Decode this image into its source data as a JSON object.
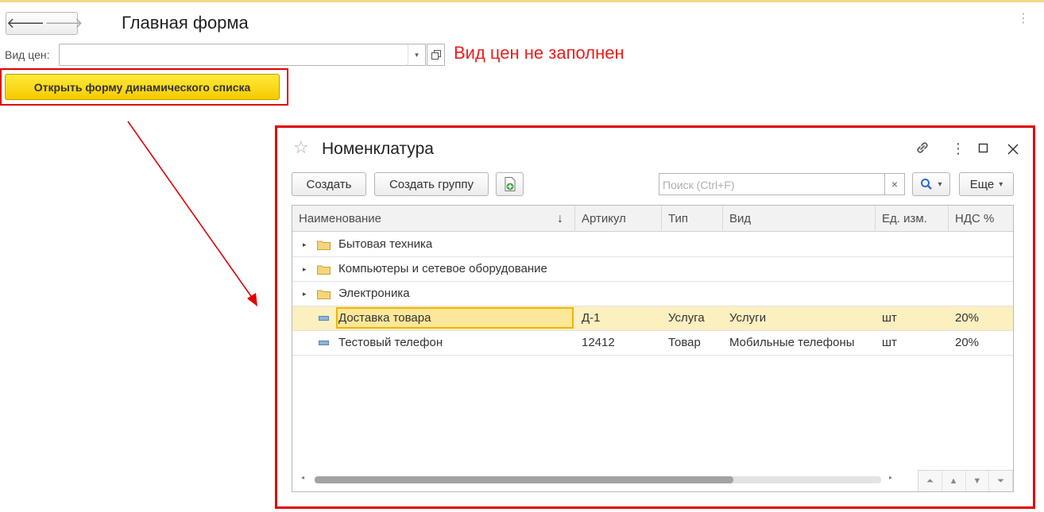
{
  "header": {
    "back_icon": "arrow-left-icon",
    "forward_icon": "arrow-right-icon",
    "back_glyph": "🡐",
    "forward_glyph": "🡒",
    "title": "Главная форма",
    "more_glyph": "⋮"
  },
  "price_field": {
    "label": "Вид цен:",
    "value": "",
    "dropdown_glyph": "▾",
    "error": "Вид цен не заполнен"
  },
  "open_button": {
    "label": "Открыть форму динамического списка"
  },
  "list_window": {
    "title": "Номенклатура",
    "star_glyph": "☆",
    "link_glyph": "🔗",
    "more_glyph": "⋮",
    "maximize_glyph": "☐",
    "close_glyph": "✕",
    "toolbar": {
      "create_label": "Создать",
      "create_group_label": "Создать группу",
      "search_placeholder": "Поиск (Ctrl+F)",
      "clear_glyph": "×",
      "search_dropdown_glyph": "▾",
      "more_label": "Еще",
      "more_dropdown_glyph": "▾"
    },
    "columns": [
      "Наименование",
      "Артикул",
      "Тип",
      "Вид",
      "Ед. изм.",
      "НДС %"
    ],
    "sort_glyph": "↓",
    "groups": [
      {
        "name": "Бытовая техника"
      },
      {
        "name": "Компьютеры и сетевое оборудование"
      },
      {
        "name": "Электроника"
      }
    ],
    "items": [
      {
        "name": "Доставка товара",
        "article": "Д-1",
        "type": "Услуга",
        "kind": "Услуги",
        "unit": "шт",
        "vat": "20%",
        "selected": true
      },
      {
        "name": "Тестовый телефон",
        "article": "12412",
        "type": "Товар",
        "kind": "Мобильные телефоны",
        "unit": "шт",
        "vat": "20%",
        "selected": false
      }
    ],
    "expand_glyph": "▸",
    "scroll_left_glyph": "◂",
    "scroll_right_glyph": "▸",
    "nav_glyphs": {
      "first": "⏶",
      "prev": "▲",
      "next": "▼",
      "last": "⏷"
    }
  },
  "colors": {
    "error_red": "#ef1c1c",
    "highlight_frame": "#e00000",
    "accent_yellow": "#f6ca00",
    "selected_row": "#fcefc0"
  }
}
